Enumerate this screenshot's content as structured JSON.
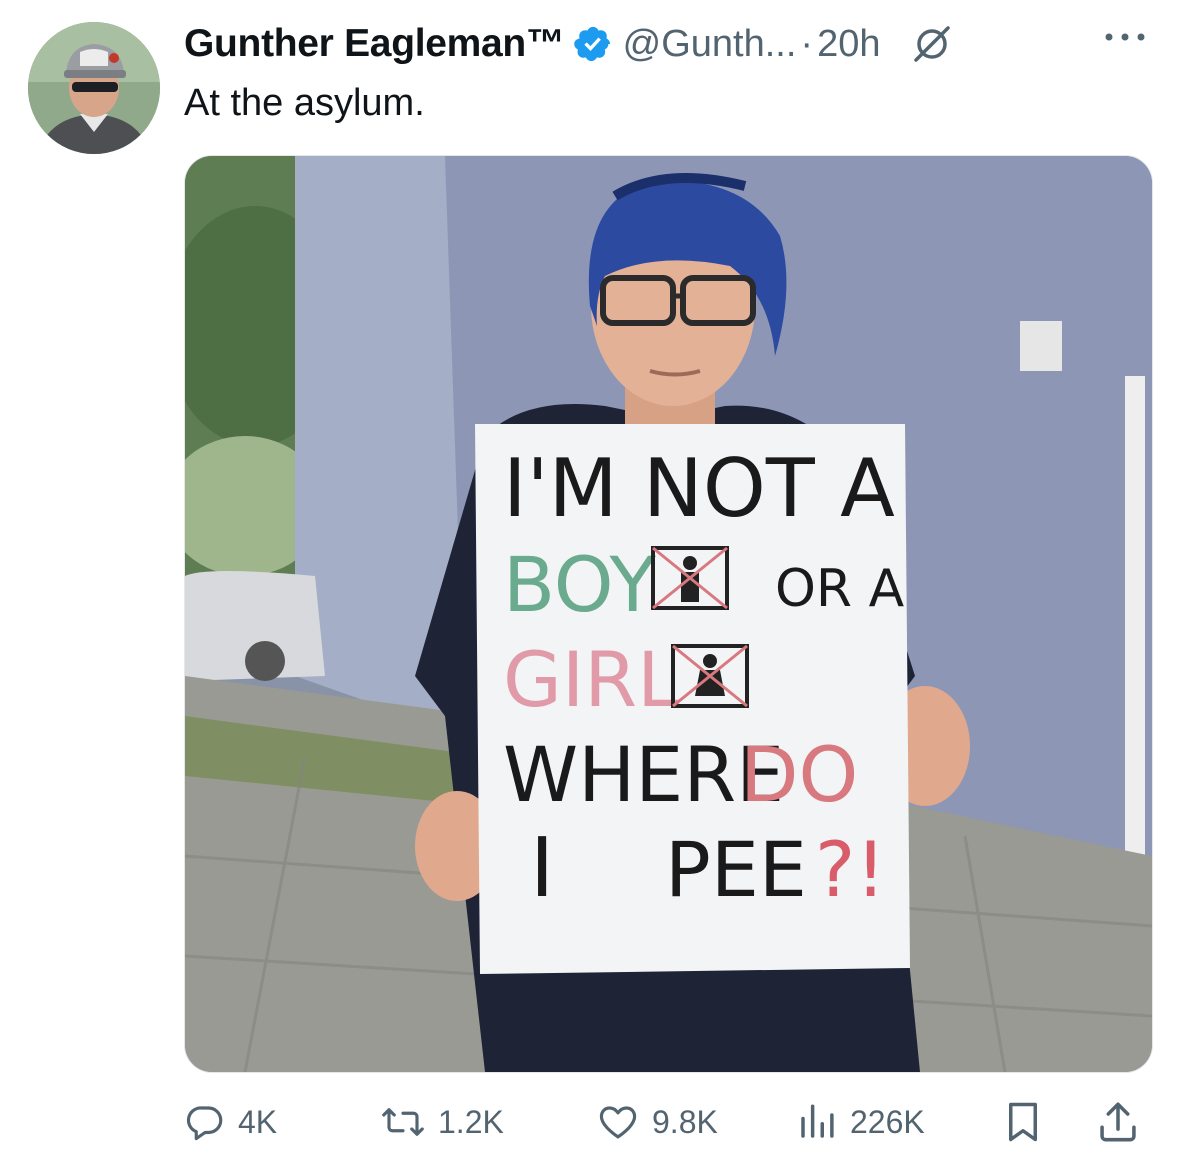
{
  "tweet": {
    "author_name": "Gunther Eagleman™",
    "handle": "@Gunth...",
    "time_separator": "·",
    "time": "20h",
    "text": "At the asylum."
  },
  "icons": {
    "verified": "verified-badge-icon",
    "grok": "grok-icon",
    "more": "more-options-icon",
    "reply": "reply-icon",
    "retweet": "retweet-icon",
    "like": "like-icon",
    "views": "views-icon",
    "bookmark": "bookmark-icon",
    "share": "share-icon"
  },
  "colors": {
    "verified_blue": "#1d9bf0",
    "secondary_text": "#536471",
    "primary_text": "#0f1419"
  },
  "media": {
    "sign_lines": {
      "line1": "I'M NOT A",
      "boy": "BOY",
      "or_a": "OR A",
      "girl": "GIRL",
      "where": "WHERE",
      "do": "DO",
      "i": "I",
      "pee": "PEE",
      "punct": "?!"
    }
  },
  "actions": {
    "replies": "4K",
    "retweets": "1.2K",
    "likes": "9.8K",
    "views": "226K"
  }
}
